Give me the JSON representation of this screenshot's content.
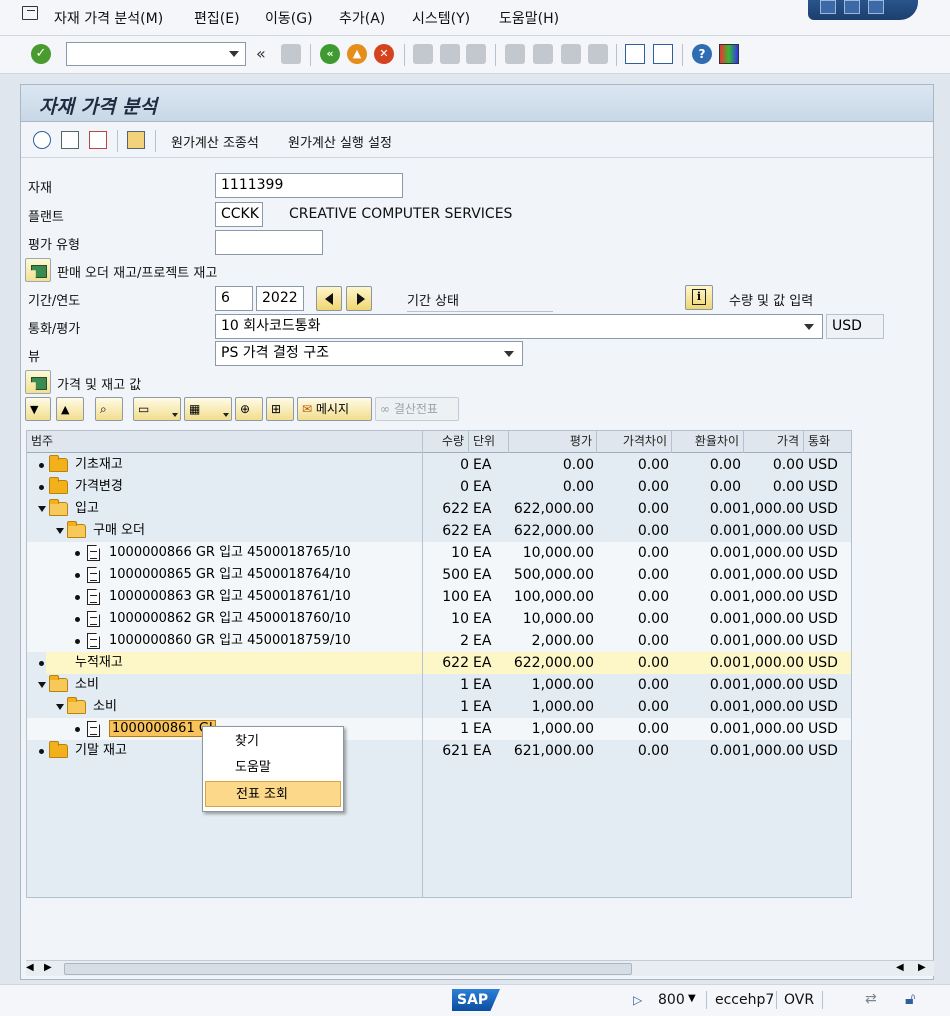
{
  "menu": [
    "자재 가격 분석(M)",
    "편집(E)",
    "이동(G)",
    "추가(A)",
    "시스템(Y)",
    "도움말(H)"
  ],
  "toolbar": {
    "command_value": "",
    "back_label": "«"
  },
  "page_title": "자재 가격 분석",
  "app_toolbar": {
    "link1": "원가계산 조종석",
    "link2": "원가계산 실행 설정"
  },
  "form": {
    "material_label": "자재",
    "material_value": "1111399",
    "plant_label": "플랜트",
    "plant_value": "CCKK",
    "plant_desc": "CREATIVE COMPUTER SERVICES",
    "valuation_type_label": "평가 유형",
    "valuation_type_value": "",
    "sales_order_toggle": "판매 오더 재고/프로젝트 재고",
    "period_label": "기간/연도",
    "period_value": "6",
    "year_value": "2022",
    "period_status_label": "기간 상태",
    "qty_value_entry": "수량 및 값 입력",
    "currency_label": "통화/평가",
    "currency_value": "10 회사코드통화",
    "currency_code": "USD",
    "view_label": "뷰",
    "view_value": "PS 가격 결정 구조",
    "prices_toggle": "가격 및 재고 값"
  },
  "alv": {
    "message_button": "메시지",
    "closing_doc_button": "결산전표"
  },
  "grid": {
    "headers": [
      "범주",
      "수량",
      "단위",
      "평가",
      "가격차이",
      "환율차이",
      "가격",
      "통화"
    ],
    "rows": [
      {
        "level": 0,
        "icon": "folder",
        "expand": "none",
        "label": "기초재고",
        "qty": "0",
        "unit": "EA",
        "valuation": "0.00",
        "price_diff": "0.00",
        "fx_diff": "0.00",
        "price": "0.00",
        "curr": "USD",
        "style": "base"
      },
      {
        "level": 0,
        "icon": "folder",
        "expand": "none",
        "label": "가격변경",
        "qty": "0",
        "unit": "EA",
        "valuation": "0.00",
        "price_diff": "0.00",
        "fx_diff": "0.00",
        "price": "0.00",
        "curr": "USD",
        "style": "base"
      },
      {
        "level": 0,
        "icon": "folder-open",
        "expand": "open",
        "label": "입고",
        "qty": "622",
        "unit": "EA",
        "valuation": "622,000.00",
        "price_diff": "0.00",
        "fx_diff": "0.00",
        "price": "1,000.00",
        "curr": "USD",
        "style": "base"
      },
      {
        "level": 1,
        "icon": "folder-open",
        "expand": "open",
        "label": "구매 오더",
        "qty": "622",
        "unit": "EA",
        "valuation": "622,000.00",
        "price_diff": "0.00",
        "fx_diff": "0.00",
        "price": "1,000.00",
        "curr": "USD",
        "style": "base"
      },
      {
        "level": 2,
        "icon": "doc",
        "expand": "none",
        "label": "1000000866 GR 입고 4500018765/10",
        "qty": "10",
        "unit": "EA",
        "valuation": "10,000.00",
        "price_diff": "0.00",
        "fx_diff": "0.00",
        "price": "1,000.00",
        "curr": "USD",
        "style": "alt"
      },
      {
        "level": 2,
        "icon": "doc",
        "expand": "none",
        "label": "1000000865 GR 입고 4500018764/10",
        "qty": "500",
        "unit": "EA",
        "valuation": "500,000.00",
        "price_diff": "0.00",
        "fx_diff": "0.00",
        "price": "1,000.00",
        "curr": "USD",
        "style": "alt"
      },
      {
        "level": 2,
        "icon": "doc",
        "expand": "none",
        "label": "1000000863 GR 입고 4500018761/10",
        "qty": "100",
        "unit": "EA",
        "valuation": "100,000.00",
        "price_diff": "0.00",
        "fx_diff": "0.00",
        "price": "1,000.00",
        "curr": "USD",
        "style": "alt"
      },
      {
        "level": 2,
        "icon": "doc",
        "expand": "none",
        "label": "1000000862 GR 입고 4500018760/10",
        "qty": "10",
        "unit": "EA",
        "valuation": "10,000.00",
        "price_diff": "0.00",
        "fx_diff": "0.00",
        "price": "1,000.00",
        "curr": "USD",
        "style": "alt"
      },
      {
        "level": 2,
        "icon": "doc",
        "expand": "none",
        "label": "1000000860 GR 입고 4500018759/10",
        "qty": "2",
        "unit": "EA",
        "valuation": "2,000.00",
        "price_diff": "0.00",
        "fx_diff": "0.00",
        "price": "1,000.00",
        "curr": "USD",
        "style": "alt"
      },
      {
        "level": 0,
        "icon": "none",
        "expand": "none",
        "label": "누적재고",
        "qty": "622",
        "unit": "EA",
        "valuation": "622,000.00",
        "price_diff": "0.00",
        "fx_diff": "0.00",
        "price": "1,000.00",
        "curr": "USD",
        "style": "yellow"
      },
      {
        "level": 0,
        "icon": "folder-open",
        "expand": "open",
        "label": "소비",
        "qty": "1",
        "unit": "EA",
        "valuation": "1,000.00",
        "price_diff": "0.00",
        "fx_diff": "0.00",
        "price": "1,000.00",
        "curr": "USD",
        "style": "base"
      },
      {
        "level": 1,
        "icon": "folder-open",
        "expand": "open",
        "label": "소비",
        "qty": "1",
        "unit": "EA",
        "valuation": "1,000.00",
        "price_diff": "0.00",
        "fx_diff": "0.00",
        "price": "1,000.00",
        "curr": "USD",
        "style": "base"
      },
      {
        "level": 2,
        "icon": "doc",
        "expand": "none",
        "label": "1000000861 GI",
        "qty": "1",
        "unit": "EA",
        "valuation": "1,000.00",
        "price_diff": "0.00",
        "fx_diff": "0.00",
        "price": "1,000.00",
        "curr": "USD",
        "style": "alt",
        "selected": true
      },
      {
        "level": 0,
        "icon": "folder",
        "expand": "none",
        "label": "기말 재고",
        "qty": "621",
        "unit": "EA",
        "valuation": "621,000.00",
        "price_diff": "0.00",
        "fx_diff": "0.00",
        "price": "1,000.00",
        "curr": "USD",
        "style": "base"
      }
    ]
  },
  "context_menu": [
    "찾기",
    "도움말",
    "전표 조회"
  ],
  "status": {
    "client": "800",
    "server": "eccehp7",
    "mode": "OVR"
  },
  "logo_text": "SAP"
}
